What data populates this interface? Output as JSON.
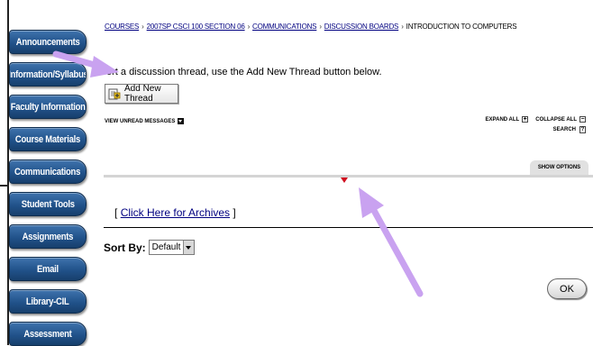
{
  "sidebar": {
    "items": [
      {
        "label": "Announcements"
      },
      {
        "label": "Information/Syllabus"
      },
      {
        "label": "Faculty Information"
      },
      {
        "label": "Course Materials"
      },
      {
        "label": "Communications"
      },
      {
        "label": "Student Tools"
      },
      {
        "label": "Assignments"
      },
      {
        "label": "Email"
      },
      {
        "label": "Library-CIL"
      },
      {
        "label": "Assessment"
      }
    ]
  },
  "breadcrumb": {
    "items": [
      {
        "label": "COURSES",
        "link": true
      },
      {
        "label": "2007SP CSCI 100 SECTION 06",
        "link": true
      },
      {
        "label": "COMMUNICATIONS",
        "link": true
      },
      {
        "label": "DISCUSSION BOARDS",
        "link": true
      },
      {
        "label": "INTRODUCTION TO COMPUTERS",
        "link": false
      }
    ],
    "separator": "›"
  },
  "instructions": "ort a discussion thread, use the Add New Thread button below.",
  "add_thread_button": "Add New Thread",
  "view_unread": "VIEW UNREAD MESSAGES",
  "expand_all": "EXPAND ALL",
  "collapse_all": "COLLAPSE ALL",
  "search": "SEARCH",
  "show_options": "SHOW OPTIONS",
  "archives": {
    "open": "[",
    "link": "Click Here for Archives",
    "close": "]"
  },
  "sort_by": {
    "label": "Sort By:",
    "selected": "Default"
  },
  "ok_button": "OK",
  "colors": {
    "nav_blue": "#21528a",
    "link": "#000080",
    "annotation_arrow": "#c9a2f0",
    "marker": "#d01020"
  }
}
